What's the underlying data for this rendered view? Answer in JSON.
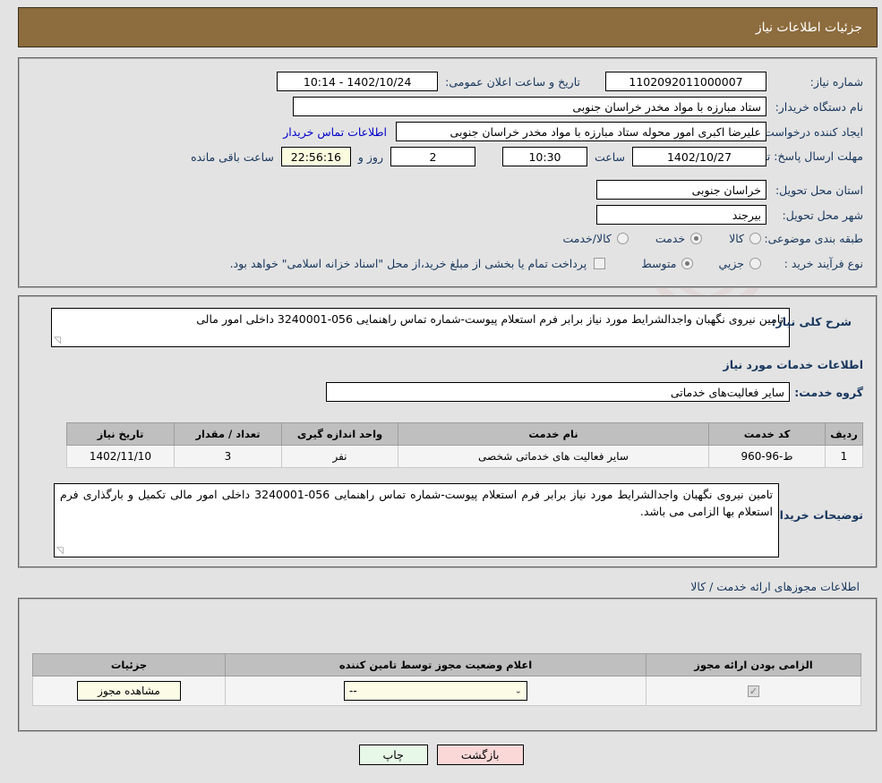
{
  "header": {
    "title": "جزئیات اطلاعات نیاز"
  },
  "colors": {
    "header_bg": "#8d6c3d",
    "page_bg": "#e3e3e3",
    "label": "#17365d",
    "link": "#0000cc",
    "print_btn": "#e8f8e8",
    "back_btn": "#fbd8d8",
    "timer_bg": "#fbfbe0",
    "table_header": "#bfbfbf"
  },
  "top_form": {
    "need_number_label": "شماره نیاز:",
    "need_number_value": "1102092011000007",
    "announce_label": "تاریخ و ساعت اعلان عمومی:",
    "announce_value": "1402/10/24 - 10:14",
    "buyer_org_label": "نام دستگاه خریدار:",
    "buyer_org_value": "ستاد مبارزه با مواد مخدر خراسان جنوبی",
    "requester_label": "ایجاد کننده درخواست:",
    "requester_value": "علیرضا اکبری امور محوله ستاد مبارزه با مواد مخدر خراسان جنوبی",
    "contact_link": "اطلاعات تماس خریدار",
    "deadline_label": "مهلت ارسال پاسخ: تا تاریخ:",
    "deadline_date": "1402/10/27",
    "deadline_hour_label": "ساعت",
    "deadline_hour": "10:30",
    "days_remaining": "2",
    "days_word": "روز و",
    "time_remaining": "22:56:16",
    "remaining_suffix": "ساعت باقی مانده",
    "province_label": "استان محل تحویل:",
    "province_value": "خراسان جنوبی",
    "city_label": "شهر محل تحویل:",
    "city_value": "بیرجند",
    "category_label": "طبقه بندی موضوعی:",
    "category_options": [
      {
        "label": "کالا",
        "selected": false
      },
      {
        "label": "خدمت",
        "selected": true
      },
      {
        "label": "کالا/خدمت",
        "selected": false
      }
    ],
    "process_label": "نوع فرآیند خرید :",
    "process_options": [
      {
        "label": "جزیي",
        "selected": false
      },
      {
        "label": "متوسط",
        "selected": true
      }
    ],
    "treasury_checkbox_checked": false,
    "treasury_note": "پرداخت تمام یا بخشی از مبلغ خرید،از محل \"اسناد خزانه اسلامی\" خواهد بود."
  },
  "middle": {
    "summary_label": "شرح کلی نیاز:",
    "summary_value": "تامین نیروی نگهبان واجدالشرایط مورد نیاز برابر فرم استعلام پیوست-شماره تماس راهنمایی 056-3240001 داخلی امور مالی",
    "services_title": "اطلاعات خدمات مورد نیاز",
    "service_group_label": "گروه خدمت:",
    "service_group_value": "سایر فعالیت‌های خدماتی",
    "table": {
      "columns": [
        "ردیف",
        "کد خدمت",
        "نام خدمت",
        "واحد اندازه گیری",
        "تعداد / مقدار",
        "تاریخ نیاز"
      ],
      "rows": [
        {
          "radif": "1",
          "code": "ط-96-960",
          "name": "سایر فعالیت های خدماتی شخصی",
          "unit": "نفر",
          "quantity": "3",
          "need_date": "1402/11/10"
        }
      ]
    },
    "buyer_notes_label": "توضیحات خریدار:",
    "buyer_notes_value": "تامین نیروی نگهبان واجدالشرایط مورد نیاز برابر فرم استعلام پیوست-شماره تماس راهنمایی 056-3240001 داخلی امور مالی تکمیل و بارگذاری فرم استعلام بها الزامی می باشد."
  },
  "licenses": {
    "section_caption": "اطلاعات مجوزهای ارائه خدمت / کالا",
    "columns": [
      "الزامی بودن ارائه مجوز",
      "اعلام وضعیت مجوز توسط تامین کننده",
      "جزئیات"
    ],
    "rows": [
      {
        "required_checked": true,
        "status_value": "--",
        "details_button": "مشاهده مجوز"
      }
    ]
  },
  "footer": {
    "print_label": "چاپ",
    "back_label": "بازگشت"
  },
  "watermark": {
    "text_left": "Ana",
    "text_mid": "Tender",
    "text_dot": ".",
    "text_right": "net"
  }
}
